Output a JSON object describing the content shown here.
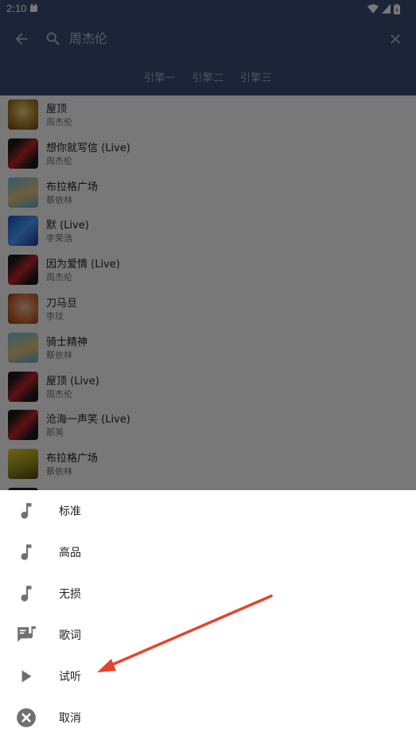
{
  "status_bar": {
    "time": "2:10"
  },
  "app_bar": {
    "search_query": "周杰伦",
    "tabs": [
      {
        "label": "引擎一"
      },
      {
        "label": "引擎二"
      },
      {
        "label": "引擎三"
      }
    ]
  },
  "songs": [
    {
      "title": "屋顶",
      "artist": "周杰伦"
    },
    {
      "title": "想你就写信 (Live)",
      "artist": "周杰伦"
    },
    {
      "title": "布拉格广场",
      "artist": "蔡依林"
    },
    {
      "title": "默 (Live)",
      "artist": "李荣浩"
    },
    {
      "title": "因为爱情 (Live)",
      "artist": "周杰伦"
    },
    {
      "title": "刀马旦",
      "artist": "李玟"
    },
    {
      "title": "骑士精神",
      "artist": "蔡依林"
    },
    {
      "title": "屋顶 (Live)",
      "artist": "周杰伦"
    },
    {
      "title": "沧海一声笑 (Live)",
      "artist": "那英"
    },
    {
      "title": "布拉格广场",
      "artist": "蔡依林"
    }
  ],
  "sheet": {
    "options": [
      {
        "label": "标准",
        "icon": "music-note-icon"
      },
      {
        "label": "高品",
        "icon": "music-note-icon"
      },
      {
        "label": "无损",
        "icon": "music-note-icon"
      },
      {
        "label": "歌词",
        "icon": "lyrics-icon"
      },
      {
        "label": "试听",
        "icon": "play-icon"
      },
      {
        "label": "取消",
        "icon": "close-circle-icon"
      }
    ]
  },
  "annotation": {
    "arrow_color": "#e8432d"
  }
}
